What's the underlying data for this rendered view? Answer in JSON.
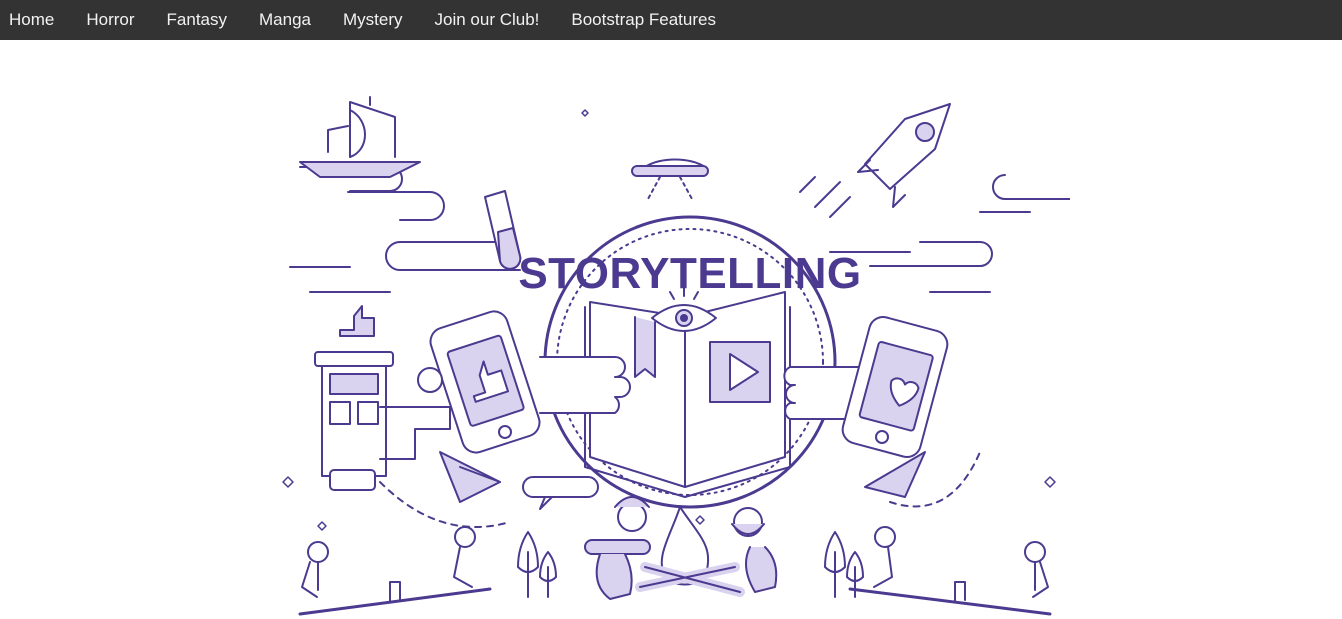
{
  "nav": {
    "items": [
      {
        "label": "Home",
        "name": "nav-home"
      },
      {
        "label": "Horror",
        "name": "nav-horror"
      },
      {
        "label": "Fantasy",
        "name": "nav-fantasy"
      },
      {
        "label": "Manga",
        "name": "nav-manga"
      },
      {
        "label": "Mystery",
        "name": "nav-mystery"
      },
      {
        "label": "Join our Club!",
        "name": "nav-join-club"
      },
      {
        "label": "Bootstrap Features",
        "name": "nav-bootstrap-features"
      }
    ]
  },
  "hero": {
    "title": "STORYTELLING",
    "accent_color": "#4b3a8f",
    "light_color": "#d9d3ef"
  },
  "colors": {
    "navbar_bg": "#333333",
    "navbar_text": "#f2f2f2",
    "page_bg": "#ffffff"
  }
}
